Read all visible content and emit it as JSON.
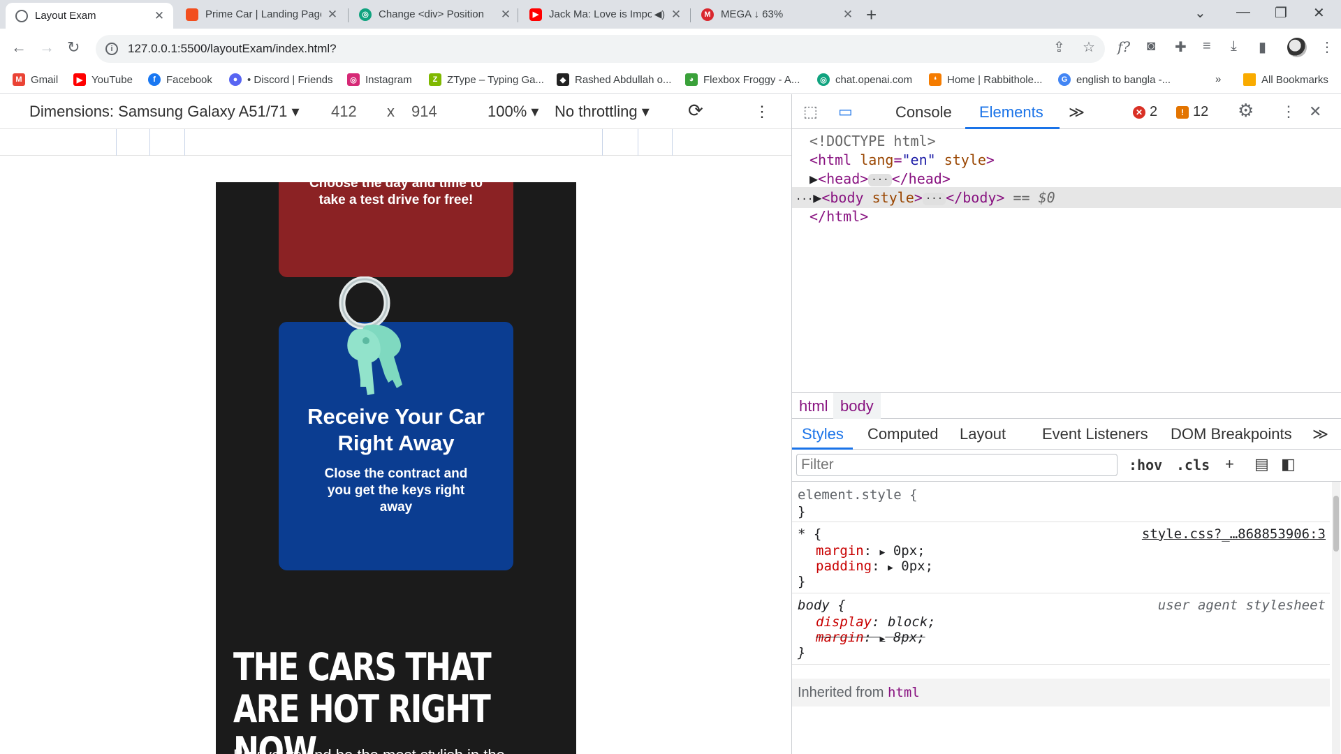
{
  "browser": {
    "tabs": [
      {
        "title": "Layout Exam",
        "favicon": "chrome-icon",
        "color": "#5f6368"
      },
      {
        "title": "Prime Car | Landing Page (Comm",
        "favicon": "figma-icon",
        "color": "#f24e1e"
      },
      {
        "title": "Change <div> Position",
        "favicon": "openai-icon",
        "color": "#10a37f"
      },
      {
        "title": "Jack Ma: Love is Important I",
        "favicon": "youtube-icon",
        "color": "#ff0000"
      },
      {
        "title": "MEGA ↓ 63%",
        "favicon": "mega-icon",
        "color": "#d9272e"
      }
    ],
    "address": "127.0.0.1:5500/layoutExam/index.html?",
    "bookmarks": [
      {
        "label": "Gmail",
        "color": "#ea4335",
        "glyph": "M"
      },
      {
        "label": "YouTube",
        "color": "#ff0000",
        "glyph": "▶"
      },
      {
        "label": "Facebook",
        "color": "#1877f2",
        "glyph": "f"
      },
      {
        "label": "• Discord | Friends",
        "color": "#5865f2",
        "glyph": "●"
      },
      {
        "label": "Instagram",
        "color": "#d62976",
        "glyph": "◎"
      },
      {
        "label": "ZType – Typing Ga...",
        "color": "#7fb800",
        "glyph": "Z"
      },
      {
        "label": "Rashed Abdullah o...",
        "color": "#222222",
        "glyph": "◆"
      },
      {
        "label": "Flexbox Froggy - A...",
        "color": "#3aa13a",
        "glyph": "🐸"
      },
      {
        "label": "chat.openai.com",
        "color": "#10a37f",
        "glyph": "◎"
      },
      {
        "label": "Home | Rabbithole...",
        "color": "#f57c00",
        "glyph": "❛"
      },
      {
        "label": "english to bangla -...",
        "color": "#4285f4",
        "glyph": "G"
      }
    ],
    "bookmarks_overflow": "»",
    "all_bookmarks": "All Bookmarks"
  },
  "device_toolbar": {
    "dimensions": "Dimensions: Samsung Galaxy A51/71",
    "width": "412",
    "times": "x",
    "height": "914",
    "zoom": "100%",
    "throttling": "No throttling"
  },
  "page": {
    "red_card_text": "Choose the day and time to take a test drive for free!",
    "blue_card_title": "Receive Your Car Right Away",
    "blue_card_text": "Close the contract and you get the keys right away",
    "hot_title": "THE CARS THAT ARE HOT RIGHT NOW",
    "hot_sub": "Buy yours and be the most stylish in the",
    "colors": {
      "red_card": "#8b2224",
      "blue_card": "#0b3d91",
      "page_bg": "#1b1b1b"
    }
  },
  "devtools": {
    "tabs": {
      "console": "Console",
      "elements": "Elements",
      "more": "≫"
    },
    "errors": "2",
    "warnings": "12",
    "dom": {
      "doctype": "<!DOCTYPE html>",
      "html_open_tag": "<html",
      "html_attr_lang": "lang",
      "html_attr_lang_val": "\"en\"",
      "html_attr_style": "style",
      "head_open": "<head>",
      "head_close": "</head>",
      "body_open": "<body",
      "body_attr": "style",
      "body_close": "</body>",
      "selected_marker": "== $0",
      "html_close": "</html>"
    },
    "breadcrumbs": [
      "html",
      "body"
    ],
    "style_tabs": [
      "Styles",
      "Computed",
      "Layout",
      "Event Listeners",
      "DOM Breakpoints"
    ],
    "style_tabs_more": "≫",
    "filter_placeholder": "Filter",
    "hov": ":hov",
    "cls": ".cls",
    "rules": {
      "element_style_selector": "element.style {",
      "close": "}",
      "star_selector": "* {",
      "star_source": "style.css?_…868853906:3",
      "margin_prop": "margin",
      "margin_val": "0px;",
      "padding_prop": "padding",
      "padding_val": "0px;",
      "body_selector": "body {",
      "body_source": "user agent stylesheet",
      "display_prop": "display",
      "display_val": "block;",
      "body_margin_prop": "margin",
      "body_margin_val": "8px;"
    },
    "inherited_label": "Inherited from",
    "inherited_tag": "html"
  }
}
